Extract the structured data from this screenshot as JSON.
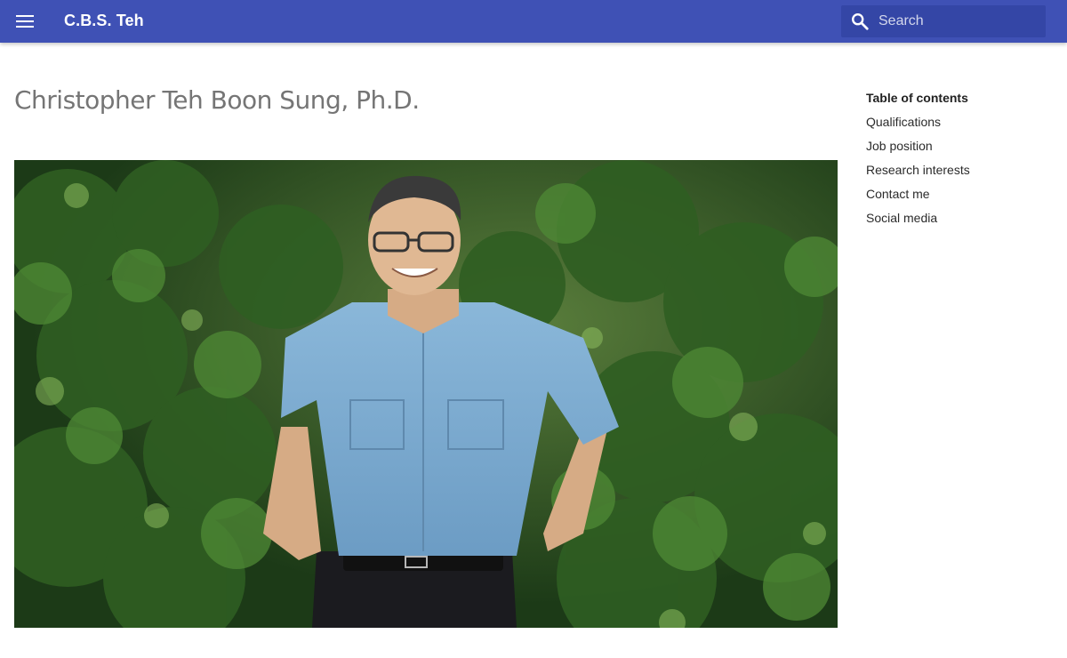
{
  "header": {
    "menu_icon": "hamburger-menu-icon",
    "site_title": "C.B.S. Teh",
    "search": {
      "icon": "search-icon",
      "placeholder": "Search",
      "value": ""
    },
    "background_color": "#3f51b5"
  },
  "main": {
    "page_title": "Christopher Teh Boon Sung, Ph.D."
  },
  "toc": {
    "title": "Table of contents",
    "items": [
      {
        "label": "Qualifications"
      },
      {
        "label": "Job position"
      },
      {
        "label": "Research interests"
      },
      {
        "label": "Contact me"
      },
      {
        "label": "Social media"
      }
    ]
  }
}
